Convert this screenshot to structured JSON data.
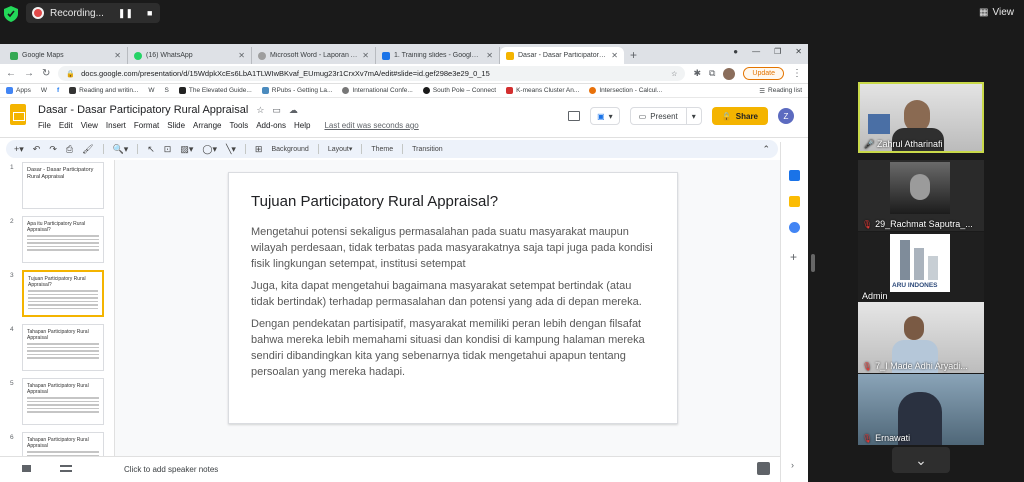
{
  "zoom": {
    "recording_label": "Recording...",
    "pause_label": "❚❚",
    "stop_label": "■",
    "view_label": "View"
  },
  "browser": {
    "tabs": [
      {
        "title": "Google Maps",
        "color": "#34a853"
      },
      {
        "title": "(16) WhatsApp",
        "color": "#25d366"
      },
      {
        "title": "Microsoft Word - Laporan Akhir",
        "color": "#9e9e9e"
      },
      {
        "title": "1. Training slides - Google Drive",
        "color": "#1a73e8"
      },
      {
        "title": "Dasar - Dasar Participatory Rural",
        "color": "#f4b400"
      }
    ],
    "url": "docs.google.com/presentation/d/15WdpkXcEs6LbA1TLWIwBKvaf_EUmug23r1CrxXv7mA/edit#slide=id.gef298e3e29_0_15",
    "update_label": "Update",
    "bookmarks": [
      {
        "label": "Apps",
        "color": "#4285f4"
      },
      {
        "label": "W",
        "color": "#555555"
      },
      {
        "label": "f",
        "color": "#1877f2"
      },
      {
        "label": "Reading and writin...",
        "color": "#333333"
      },
      {
        "label": "W",
        "color": "#555555"
      },
      {
        "label": "S",
        "color": "#555555"
      },
      {
        "label": "The Elevated Guide...",
        "color": "#222222"
      },
      {
        "label": "RPubs - Getting La...",
        "color": "#4b8bbe"
      },
      {
        "label": "International Confe...",
        "color": "#777777"
      },
      {
        "label": "South Pole – Connect",
        "color": "#1a1a1a"
      },
      {
        "label": "K-means Cluster An...",
        "color": "#d32f2f"
      },
      {
        "label": "Intersection - Calcul...",
        "color": "#e8710a"
      }
    ],
    "reading_list": "Reading list"
  },
  "slides": {
    "doc_title": "Dasar - Dasar Participatory Rural Appraisal",
    "menu": [
      "File",
      "Edit",
      "View",
      "Insert",
      "Format",
      "Slide",
      "Arrange",
      "Tools",
      "Add-ons",
      "Help"
    ],
    "last_edit": "Last edit was seconds ago",
    "present_label": "Present",
    "share_label": "Share",
    "avatar_initial": "Z",
    "toolbar": {
      "background": "Background",
      "layout": "Layout",
      "theme": "Theme",
      "transition": "Transition"
    },
    "thumbnails": [
      {
        "num": "1",
        "title": "Dasar - Dasar Participatory Rural Appraisal"
      },
      {
        "num": "2",
        "title": "Apa itu Participatory Rural Appraisal?"
      },
      {
        "num": "3",
        "title": "Tujuan Participatory Rural Appraisal?"
      },
      {
        "num": "4",
        "title": "Tahapan Participatory Rural Appraisal"
      },
      {
        "num": "5",
        "title": "Tahapan Participatory Rural Appraisal"
      },
      {
        "num": "6",
        "title": "Tahapan Participatory Rural Appraisal"
      }
    ],
    "current_slide": {
      "title": "Tujuan Participatory Rural Appraisal?",
      "paragraphs": [
        "Mengetahui potensi sekaligus permasalahan pada suatu masyarakat maupun wilayah perdesaan, tidak terbatas pada masyarakatnya saja tapi juga pada kondisi fisik lingkungan setempat, institusi setempat",
        "Juga, kita dapat mengetahui bagaimana masyarakat setempat bertindak (atau tidak bertindak) terhadap permasalahan dan potensi yang ada di depan mereka.",
        "Dengan pendekatan partisipatif, masyarakat memiliki peran lebih dengan filsafat bahwa mereka lebih memahami situasi dan kondisi di kampung halaman mereka sendiri dibandingkan kita yang sebenarnya tidak mengetahui apapun tentang persoalan yang mereka hadapi."
      ]
    },
    "speaker_notes": "Click to add speaker notes"
  },
  "participants": [
    {
      "name": "Zahrul Atharinafi",
      "muted": false
    },
    {
      "name": "29_Rachmat Saputra_...",
      "muted": true
    },
    {
      "name": "Admin",
      "muted": false,
      "logo_text": "ARU INDONES"
    },
    {
      "name": "7_I Made Adhi Aryadi...",
      "muted": true
    },
    {
      "name": "Ernawati",
      "muted": true
    }
  ],
  "colors": {
    "slides_accent": "#f4b400",
    "active_speaker_border": "#c9d94a",
    "muted": "#e53935"
  }
}
